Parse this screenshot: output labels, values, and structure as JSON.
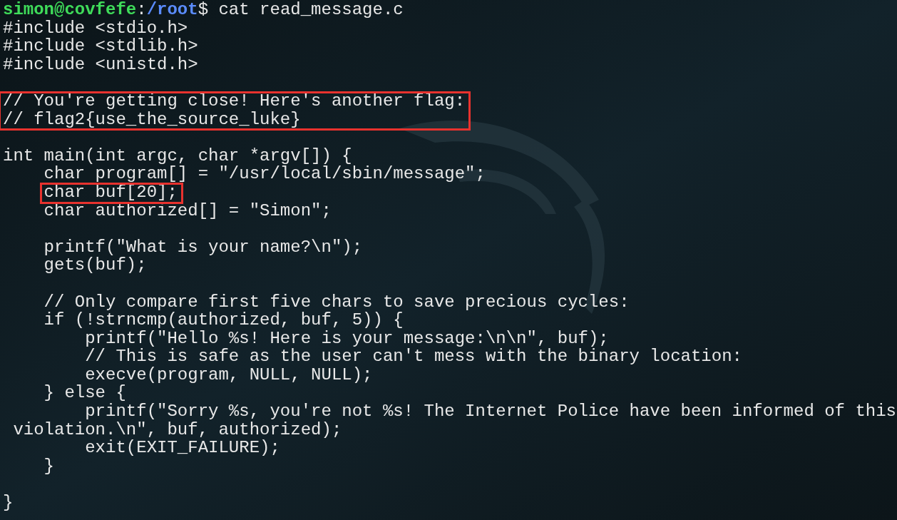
{
  "prompt": {
    "user_host": "simon@covfefe",
    "separator": ":",
    "path": "/root",
    "symbol": "$",
    "command": "cat read_message.c"
  },
  "blocks": [
    [
      {
        "text": "#include <stdio.h>",
        "highlighted": false
      },
      {
        "text": "#include <stdlib.h>",
        "highlighted": false
      },
      {
        "text": "#include <unistd.h>",
        "highlighted": false
      }
    ],
    [
      {
        "text": "// You're getting close! Here's another flag:",
        "highlighted": true
      },
      {
        "text": "// flag2{use_the_source_luke}",
        "highlighted": true
      }
    ],
    [
      {
        "text": "int main(int argc, char *argv[]) {",
        "highlighted": false
      },
      {
        "text": "    char program[] = \"/usr/local/sbin/message\";",
        "highlighted": false
      },
      {
        "text": "    char buf[20];",
        "highlighted": true
      },
      {
        "text": "    char authorized[] = \"Simon\";",
        "highlighted": false
      }
    ],
    [
      {
        "text": "    printf(\"What is your name?\\n\");",
        "highlighted": false
      },
      {
        "text": "    gets(buf);",
        "highlighted": false
      }
    ],
    [
      {
        "text": "    // Only compare first five chars to save precious cycles:",
        "highlighted": false
      },
      {
        "text": "    if (!strncmp(authorized, buf, 5)) {",
        "highlighted": false
      },
      {
        "text": "        printf(\"Hello %s! Here is your message:\\n\\n\", buf);",
        "highlighted": false
      },
      {
        "text": "        // This is safe as the user can't mess with the binary location:",
        "highlighted": false
      },
      {
        "text": "        execve(program, NULL, NULL);",
        "highlighted": false
      },
      {
        "text": "    } else {",
        "highlighted": false
      },
      {
        "text": "        printf(\"Sorry %s, you're not %s! The Internet Police have been informed of this",
        "highlighted": false
      },
      {
        "text": " violation.\\n\", buf, authorized);",
        "highlighted": false
      },
      {
        "text": "        exit(EXIT_FAILURE);",
        "highlighted": false
      },
      {
        "text": "    }",
        "highlighted": false
      }
    ],
    [
      {
        "text": "}",
        "highlighted": false
      }
    ]
  ]
}
